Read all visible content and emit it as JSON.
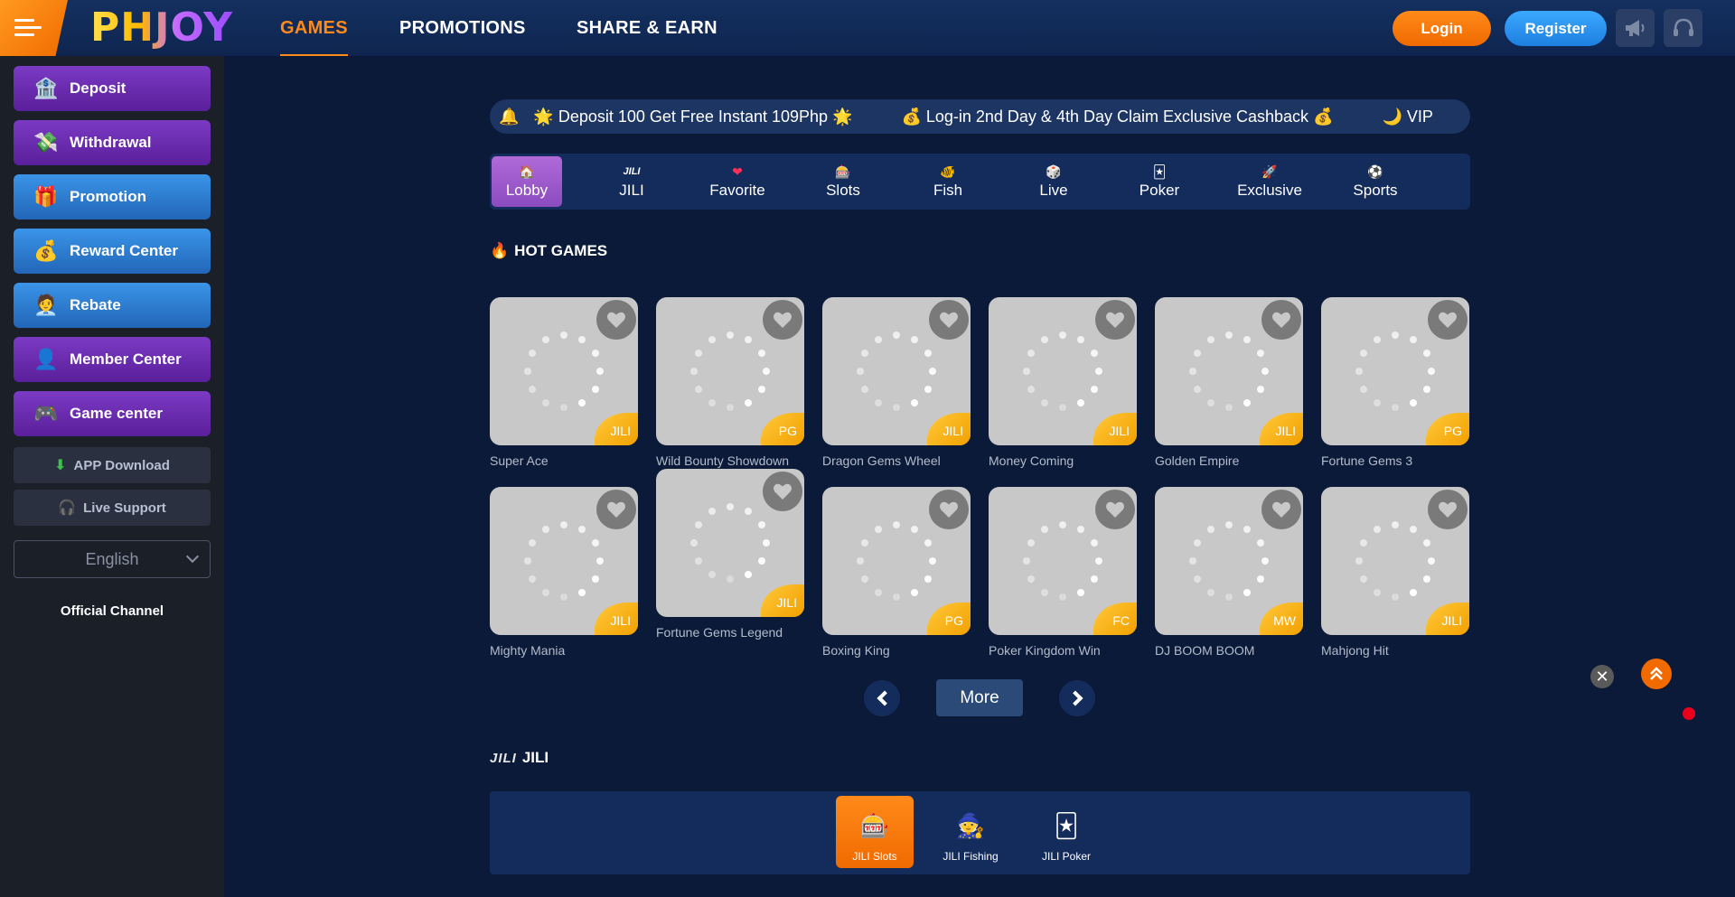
{
  "header": {
    "logo_text": "PHJOY",
    "nav": [
      "GAMES",
      "PROMOTIONS",
      "SHARE & EARN"
    ],
    "active_nav": "GAMES",
    "login_label": "Login",
    "register_label": "Register",
    "accent_color": "#ff8a1a",
    "icons": [
      "menu-icon",
      "megaphone-icon",
      "headset-icon"
    ]
  },
  "sidebar": {
    "buttons": [
      {
        "label": "Deposit",
        "icon": "deposit-icon",
        "color": "purple"
      },
      {
        "label": "Withdrawal",
        "icon": "withdrawal-icon",
        "color": "purple"
      },
      {
        "label": "Promotion",
        "icon": "gift-icon",
        "color": "blue"
      },
      {
        "label": "Reward Center",
        "icon": "reward-icon",
        "color": "blue"
      },
      {
        "label": "Rebate",
        "icon": "rebate-icon",
        "color": "blue"
      },
      {
        "label": "Member Center",
        "icon": "member-icon",
        "color": "purple"
      },
      {
        "label": "Game center",
        "icon": "gamepad-icon",
        "color": "purple"
      }
    ],
    "app_download": "APP Download",
    "live_support": "Live Support",
    "language": "English",
    "official_channel": "Official Channel"
  },
  "ticker": {
    "messages": [
      "🌟 Deposit 100 Get Free Instant 109Php 🌟",
      "💰 Log-in 2nd Day & 4th Day Claim Exclusive Cashback 💰",
      "🌙 VIP"
    ]
  },
  "categories": [
    {
      "label": "Lobby",
      "icon": "🏠"
    },
    {
      "label": "JILI",
      "icon": "JILI"
    },
    {
      "label": "Favorite",
      "icon": "❤"
    },
    {
      "label": "Slots",
      "icon": "🎰"
    },
    {
      "label": "Fish",
      "icon": "🐠"
    },
    {
      "label": "Live",
      "icon": "🎲"
    },
    {
      "label": "Poker",
      "icon": "🃏"
    },
    {
      "label": "Exclusive",
      "icon": "🚀"
    },
    {
      "label": "Sports",
      "icon": "⚽"
    }
  ],
  "active_category": "Lobby",
  "hot_games": {
    "title": "HOT GAMES",
    "games": [
      {
        "name": "Super Ace",
        "provider": "JILI"
      },
      {
        "name": "Wild Bounty Showdown",
        "provider": "PG"
      },
      {
        "name": "Dragon Gems Wheel",
        "provider": "JILI"
      },
      {
        "name": "Money Coming",
        "provider": "JILI"
      },
      {
        "name": "Golden Empire",
        "provider": "JILI"
      },
      {
        "name": "Fortune Gems 3",
        "provider": "PG"
      },
      {
        "name": "Mighty Mania",
        "provider": "JILI"
      },
      {
        "name": "Fortune Gems Legend",
        "provider": "JILI"
      },
      {
        "name": "Boxing King",
        "provider": "PG"
      },
      {
        "name": "Poker Kingdom Win",
        "provider": "FC"
      },
      {
        "name": "DJ BOOM BOOM",
        "provider": "MW"
      },
      {
        "name": "Mahjong Hit",
        "provider": "JILI"
      }
    ],
    "more_label": "More"
  },
  "jili_section": {
    "title": "JILI",
    "logo_text": "JILI",
    "providers": [
      {
        "label": "JILI Slots",
        "icon": "🎰"
      },
      {
        "label": "JILI Fishing",
        "icon": "🧙"
      },
      {
        "label": "JILI Poker",
        "icon": "🃏"
      }
    ],
    "active": "JILI Slots"
  },
  "floating": {
    "close_symbol": "✕"
  }
}
